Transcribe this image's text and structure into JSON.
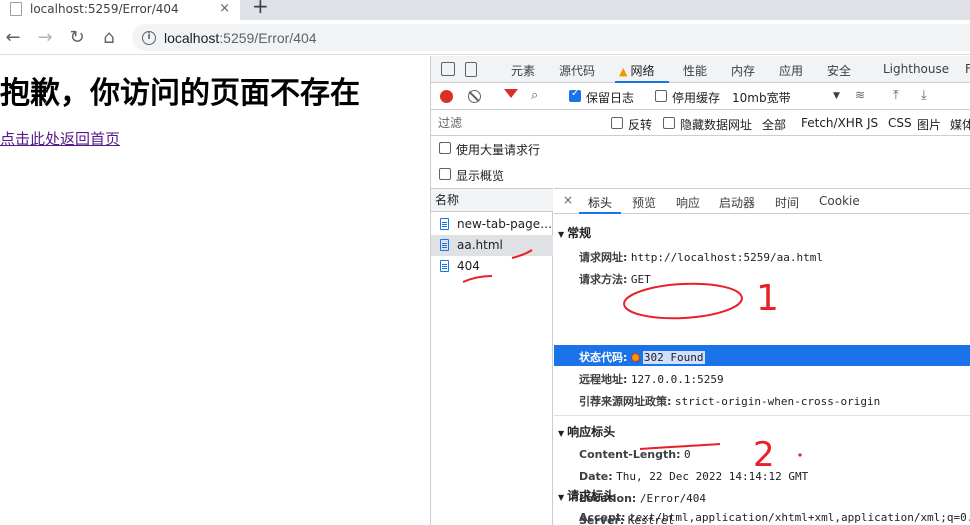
{
  "browser": {
    "tab_title": "localhost:5259/Error/404",
    "tab_close": "×",
    "new_tab": "+",
    "nav_back": "←",
    "nav_forward": "→",
    "nav_reload": "↻",
    "nav_home": "⌂",
    "url_host": "localhost",
    "url_path": ":5259/Error/404",
    "info_icon": "i"
  },
  "page": {
    "heading": "抱歉，你访问的页面不存在",
    "link": "点击此处返回首页"
  },
  "devtools": {
    "tabs": [
      "元素",
      "源代码",
      "网络",
      "性能",
      "内存",
      "应用",
      "安全",
      "Lighthouse",
      "F"
    ],
    "active_tab": "网络",
    "toolbar": {
      "preserve_log": "保留日志",
      "disable_cache": "停用缓存",
      "throttle": "10mb宽带",
      "dropdown": "▼",
      "wifi": "≋",
      "upload": "⤒",
      "download": "⤓",
      "search": "⌕"
    },
    "filter": {
      "placeholder": "过滤",
      "invert": "反转",
      "hide_data_urls": "隐藏数据网址",
      "types": [
        "全部",
        "Fetch/XHR",
        "JS",
        "CSS",
        "图片",
        "媒体"
      ]
    },
    "options": {
      "large_rows": "使用大量请求行",
      "overview": "显示概览"
    },
    "requests": {
      "header": "名称",
      "rows": [
        "new-tab-page-...",
        "aa.html",
        "404"
      ],
      "selected": "aa.html"
    },
    "detail": {
      "close": "×",
      "tabs": [
        "标头",
        "预览",
        "响应",
        "启动器",
        "时间",
        "Cookie"
      ],
      "active_tab": "标头",
      "general": {
        "title": "常规",
        "request_url_k": "请求网址:",
        "request_url_v": "http://localhost:5259/aa.html",
        "method_k": "请求方法:",
        "method_v": "GET",
        "status_k": "状态代码:",
        "status_v": "302 Found",
        "remote_k": "远程地址:",
        "remote_v": "127.0.0.1:5259",
        "referrer_k": "引荐来源网址政策:",
        "referrer_v": "strict-origin-when-cross-origin"
      },
      "response_headers": {
        "title": "响应标头",
        "content_length_k": "Content-Length:",
        "content_length_v": "0",
        "date_k": "Date:",
        "date_v": "Thu, 22 Dec 2022 14:14:12 GMT",
        "location_k": "Location:",
        "location_v": "/Error/404",
        "server_k": "Server:",
        "server_v": "Kestrel"
      },
      "request_headers": {
        "title": "请求标头",
        "accept_k": "Accept:",
        "accept_v": "text/html,application/xhtml+xml,application/xml;q=0."
      }
    }
  },
  "annotations": {
    "mark1": "1",
    "mark2": "2"
  },
  "colors": {
    "accent": "#1a73e8",
    "record": "#d93025",
    "annotation": "#e8202a"
  }
}
